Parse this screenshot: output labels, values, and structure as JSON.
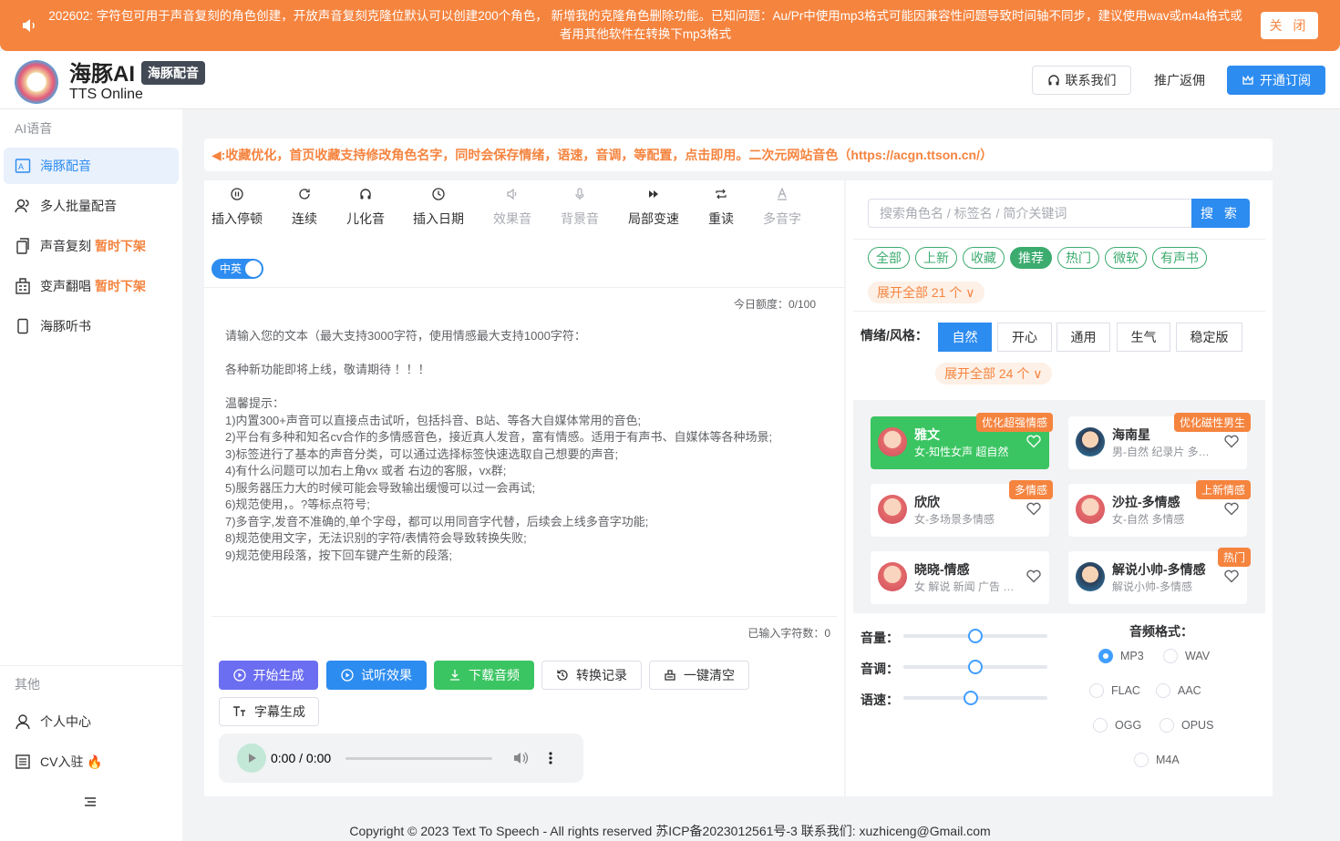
{
  "notice": {
    "text": "202602: 字符包可用于声音复刻的角色创建，开放声音复刻克隆位默认可以创建200个角色， 新增我的克隆角色删除功能。已知问题：Au/Pr中使用mp3格式可能因兼容性问题导致时间轴不同步，建议使用wav或m4a格式或者用其他软件在转换下mp3格式",
    "close_label": "关 闭"
  },
  "header": {
    "brand": "海豚AI",
    "tag": "海豚配音",
    "subtitle": "TTS Online",
    "contact_label": "联系我们",
    "promo_label": "推广返佣",
    "subscribe_label": "开通订阅"
  },
  "sidebar": {
    "section_ai": "AI语音",
    "items": [
      {
        "label": "海豚配音",
        "warn": ""
      },
      {
        "label": "多人批量配音",
        "warn": ""
      },
      {
        "label": "声音复刻",
        "warn": "暂时下架"
      },
      {
        "label": "变声翻唱",
        "warn": "暂时下架"
      },
      {
        "label": "海豚听书",
        "warn": ""
      }
    ],
    "section_other": "其他",
    "other_items": [
      {
        "label": "个人中心"
      },
      {
        "label": "CV入驻 🔥"
      }
    ]
  },
  "main_notice": "◀:收藏优化，首页收藏支持修改角色名字，同时会保存情绪，语速，音调，等配置，点击即用。二次元网站音色（https://acgn.ttson.cn/）",
  "toolbar": {
    "items": [
      {
        "label": "插入停顿",
        "icon": "pause-circle-icon"
      },
      {
        "label": "连续",
        "icon": "refresh-icon"
      },
      {
        "label": "儿化音",
        "icon": "headphones-icon"
      },
      {
        "label": "插入日期",
        "icon": "clock-icon"
      },
      {
        "label": "效果音",
        "icon": "speaker-icon"
      },
      {
        "label": "背景音",
        "icon": "mic-icon"
      },
      {
        "label": "局部变速",
        "icon": "fast-forward-icon"
      },
      {
        "label": "重读",
        "icon": "repeat-icon"
      },
      {
        "label": "多音字",
        "icon": "letter-a-icon"
      }
    ],
    "toggle_label": "中英"
  },
  "editor": {
    "quota": "今日额度：0/100",
    "placeholder": "请输入您的文本（最大支持3000字符，使用情感最大支持1000字符：\n\n各种新功能即将上线，敬请期待 ！！！\n\n温馨提示：\n1)内置300+声音可以直接点击试听，包括抖音、B站、等各大自媒体常用的音色;\n2)平台有多种和知名cv合作的多情感音色，接近真人发音，富有情感。适用于有声书、自媒体等各种场景;\n3)标签进行了基本的声音分类，可以通过选择标签快速选取自己想要的声音;\n4)有什么问题可以加右上角vx 或者 右边的客服，vx群;\n5)服务器压力大的时候可能会导致输出缓慢可以过一会再试;\n6)规范使用，。?等标点符号;\n7)多音字,发音不准确的,单个字母，都可以用同音字代替，后续会上线多音字功能;\n8)规范使用文字，无法识别的字符/表情符会导致转换失败;\n9)规范使用段落，按下回车键产生新的段落;",
    "char_count": "已输入字符数：0"
  },
  "actions": {
    "generate": "开始生成",
    "preview": "试听效果",
    "download": "下载音频",
    "history": "转换记录",
    "clear": "一键清空",
    "subtitle": "字幕生成"
  },
  "player": {
    "time": "0:00 / 0:00",
    "progress": 0
  },
  "voice_panel": {
    "search_placeholder": "搜索角色名 / 标签名 / 简介关键词",
    "search_button": "搜 索",
    "tags": [
      "全部",
      "上新",
      "收藏",
      "推荐",
      "热门",
      "微软",
      "有声书"
    ],
    "active_tag": "推荐",
    "expand_tags": "展开全部 21 个 ∨",
    "emotion_label": "情绪/风格：",
    "emotions": [
      "自然",
      "开心",
      "通用",
      "生气",
      "稳定版"
    ],
    "active_emotion": "自然",
    "expand_emotions": "展开全部 24 个 ∨",
    "voices": [
      {
        "name": "雅文",
        "desc": "女-知性女声 超自然",
        "badge": "优化超强情感",
        "selected": true,
        "gender": "f"
      },
      {
        "name": "海南星",
        "desc": "男-自然 纪录片 多情感",
        "badge": "优化磁性男生",
        "selected": false,
        "gender": "m"
      },
      {
        "name": "欣欣",
        "desc": "女-多场景多情感",
        "badge": "多情感",
        "selected": false,
        "gender": "f"
      },
      {
        "name": "沙拉-多情感",
        "desc": "女-自然 多情感",
        "badge": "上新情感",
        "selected": false,
        "gender": "f"
      },
      {
        "name": "晓晓-情感",
        "desc": "女 解说 新闻 广告 多情感",
        "badge": "",
        "selected": false,
        "gender": "f"
      },
      {
        "name": "解说小帅-多情感",
        "desc": "解说小帅-多情感",
        "badge": "热门",
        "selected": false,
        "gender": "m"
      }
    ],
    "volume_label": "音量：",
    "pitch_label": "音调：",
    "speed_label": "语速：",
    "volume": 0.5,
    "pitch": 0.5,
    "speed": 0.47,
    "format_title": "音频格式：",
    "formats": [
      "MP3",
      "WAV",
      "FLAC",
      "AAC",
      "OGG",
      "OPUS",
      "M4A"
    ],
    "active_format": "MP3"
  },
  "footer": "Copyright © 2023 Text To Speech - All rights reserved  苏ICP备2023012561号-3    联系我们: xuzhiceng@Gmail.com",
  "colors": {
    "accent": "#2d8cf0",
    "orange": "#f5843f",
    "green": "#3bc562",
    "purple": "#6b6ef0"
  }
}
